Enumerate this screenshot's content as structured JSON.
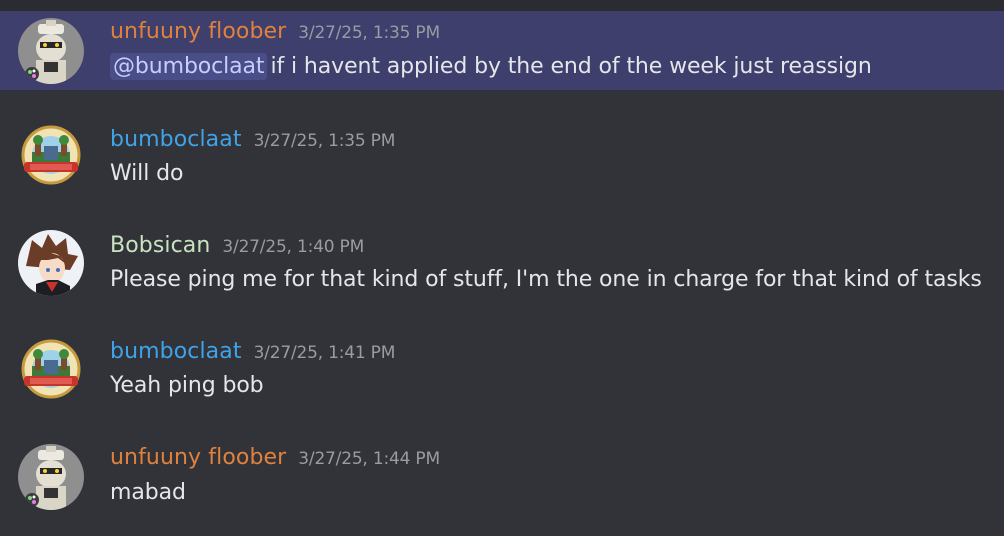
{
  "colors": {
    "background": "#323339",
    "highlight": "#3e3f6c",
    "timestamp": "#9a9ba3",
    "text": "#e5e6ea",
    "mention_bg": "#4a4e88",
    "mention_text": "#c9cdfb"
  },
  "messages": [
    {
      "author": "unfuuny floober",
      "author_color": "#e0823d",
      "timestamp": "3/27/25, 1:35 PM",
      "mention": "@bumboclaat",
      "text": "if i havent applied by the end of the week just reassign",
      "avatar": "robot-avatar-icon"
    },
    {
      "author": "bumboclaat",
      "author_color": "#3fa3e8",
      "timestamp": "3/27/25, 1:35 PM",
      "text": "Will do",
      "avatar": "crest-avatar-icon"
    },
    {
      "author": "Bobsican",
      "author_color": "#c9e4c0",
      "timestamp": "3/27/25, 1:40 PM",
      "text": "Please ping me for that kind of stuff, I'm the one in charge for that kind of tasks",
      "avatar": "anime-avatar-icon"
    },
    {
      "author": "bumboclaat",
      "author_color": "#3fa3e8",
      "timestamp": "3/27/25, 1:41 PM",
      "text": "Yeah ping bob",
      "avatar": "crest-avatar-icon"
    },
    {
      "author": "unfuuny floober",
      "author_color": "#e0823d",
      "timestamp": "3/27/25, 1:44 PM",
      "text": "mabad",
      "avatar": "robot-avatar-icon"
    }
  ]
}
